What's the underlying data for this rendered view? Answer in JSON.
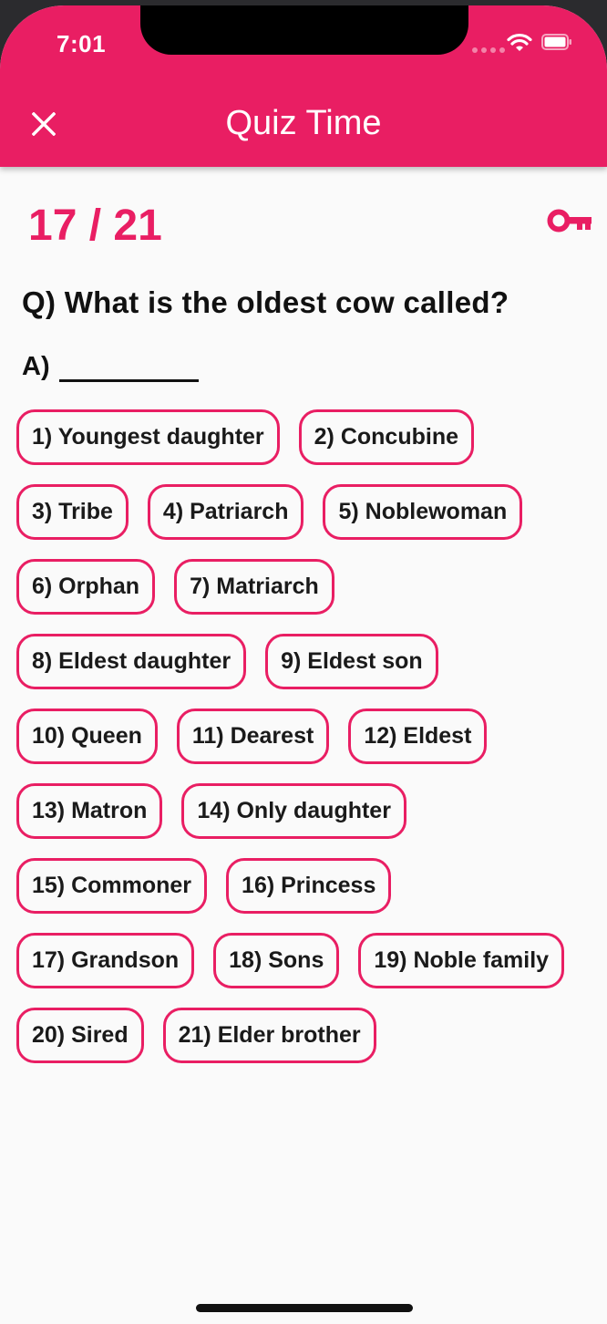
{
  "status_bar": {
    "time": "7:01"
  },
  "app_bar": {
    "title": "Quiz Time",
    "close_icon": "close-icon",
    "color": "#e91e63"
  },
  "quiz": {
    "progress_text": "17 / 21",
    "current": 17,
    "total": 21,
    "hint_icon": "key-icon",
    "question": "Q) What is the oldest cow called?",
    "answer_label": "A)"
  },
  "options": [
    "1) Youngest daughter",
    "2) Concubine",
    "3) Tribe",
    "4) Patriarch",
    "5) Noblewoman",
    "6) Orphan",
    "7) Matriarch",
    "8) Eldest daughter",
    "9) Eldest son",
    "10) Queen",
    "11) Dearest",
    "12) Eldest",
    "13) Matron",
    "14) Only daughter",
    "15) Commoner",
    "16) Princess",
    "17) Grandson",
    "18) Sons",
    "19) Noble family",
    "20) Sired",
    "21) Elder brother"
  ]
}
